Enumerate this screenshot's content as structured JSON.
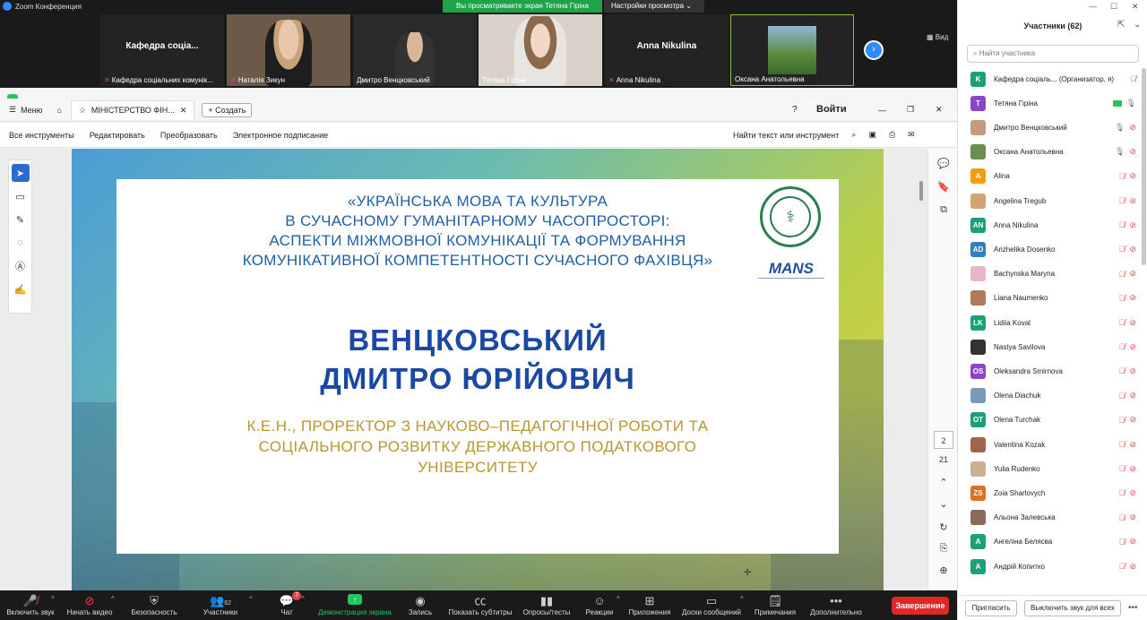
{
  "titlebar": {
    "app_title": "Zoom Конференция"
  },
  "share_banner": {
    "text": "Вы просматриваете экран Тетяна Гіріна",
    "view_settings": "Настройки просмотра"
  },
  "video_strip": {
    "view_label": "Вид",
    "tiles": [
      {
        "big": "Кафедра соціа...",
        "name": "Кафедра соціальних комунік..."
      },
      {
        "big": "",
        "name": "Наталія Зикун"
      },
      {
        "big": "",
        "name": "Дмитро Венцковський"
      },
      {
        "big": "",
        "name": "Тетяна Гіріна"
      },
      {
        "big": "Anna Nikulina",
        "name": "Anna Nikulina"
      },
      {
        "big": "",
        "name": "Оксана Анатольевна"
      }
    ]
  },
  "acrobat": {
    "menu_label": "Меню",
    "tab_title": "МІНІСТЕРСТВО ФІН...",
    "create_label": "Создать",
    "login_label": "Войти",
    "toolbar": {
      "all_tools": "Все инструменты",
      "edit": "Редактировать",
      "convert": "Преобразовать",
      "esign": "Электронное подписание",
      "find": "Найти текст или инструмент"
    },
    "page_current": "2",
    "page_total": "21"
  },
  "slide": {
    "title_lines": [
      "«УКРАЇНСЬКА МОВА ТА КУЛЬТУРА",
      "В СУЧАСНОМУ ГУМАНІТАРНОМУ ЧАСОПРОСТОРІ:",
      "АСПЕКТИ МІЖМОВНОЇ КОМУНІКАЦІЇ ТА ФОРМУВАННЯ",
      "КОМУНІКАТИВНОЇ КОМПЕТЕНТНОСТІ СУЧАСНОГО ФАХІВЦЯ»"
    ],
    "name_lines": [
      "ВЕНЦКОВСЬКИЙ",
      "ДМИТРО ЮРІЙОВИЧ"
    ],
    "position_lines": [
      "К.Е.Н., ПРОРЕКТОР З НАУКОВО–ПЕДАГОГІЧНОЇ РОБОТИ ТА",
      "СОЦІАЛЬНОГО РОЗВИТКУ ДЕРЖАВНОГО ПОДАТКОВОГО",
      "УНІВЕРСИТЕТУ"
    ],
    "logo_text": "MANS"
  },
  "controls": {
    "mute": "Включить звук",
    "video": "Начать видео",
    "security": "Безопасность",
    "participants": "Участники",
    "participants_count": "62",
    "chat": "Чат",
    "chat_badge": "7",
    "share": "Демонстрация экрана",
    "record": "Запись",
    "captions": "Показать субтитры",
    "polls": "Опросы/тесты",
    "reactions": "Реакции",
    "apps": "Приложения",
    "whiteboards": "Доски сообщений",
    "notes": "Примечания",
    "more": "Дополнительно",
    "end": "Завершение"
  },
  "panel": {
    "title": "Участники (62)",
    "search_placeholder": "Найти участника",
    "invite": "Пригласить",
    "mute_all": "Выключить звук для всех",
    "participants": [
      {
        "initials": "K",
        "color": "#1aa17a",
        "name": "Кафедра соціаль... (Организатор, я)",
        "mic": "off",
        "cam": "none"
      },
      {
        "initials": "T",
        "color": "#8e44c9",
        "name": "Тетяна Гіріна",
        "mic": "on",
        "cam": "on"
      },
      {
        "initials": "",
        "color": "#c49a7a",
        "name": "Дмитро Венцковський",
        "mic": "on",
        "cam": "off"
      },
      {
        "initials": "",
        "color": "#6b8e4e",
        "name": "Оксана Анатольевна",
        "mic": "on",
        "cam": "off"
      },
      {
        "initials": "A",
        "color": "#f59e0b",
        "name": "Alina",
        "mic": "off",
        "cam": "off"
      },
      {
        "initials": "",
        "color": "#d4a373",
        "name": "Angelina Tregub",
        "mic": "off",
        "cam": "off"
      },
      {
        "initials": "AN",
        "color": "#1aa17a",
        "name": "Anna Nikulina",
        "mic": "off",
        "cam": "off"
      },
      {
        "initials": "AD",
        "color": "#2f80c0",
        "name": "Anzhelika Dosenko",
        "mic": "off",
        "cam": "off"
      },
      {
        "initials": "",
        "color": "#e8b4c8",
        "name": "Bachynska Maryna",
        "mic": "off",
        "cam": "off"
      },
      {
        "initials": "",
        "color": "#b07a5a",
        "name": "Liana Naumenko",
        "mic": "off",
        "cam": "off"
      },
      {
        "initials": "LK",
        "color": "#1aa17a",
        "name": "Lidiia Koval",
        "mic": "off",
        "cam": "off"
      },
      {
        "initials": "",
        "color": "#333333",
        "name": "Nastya Savilova",
        "mic": "off",
        "cam": "off"
      },
      {
        "initials": "OS",
        "color": "#8e44c9",
        "name": "Oleksandra Smirnova",
        "mic": "off",
        "cam": "off"
      },
      {
        "initials": "",
        "color": "#7a9ab8",
        "name": "Olena Diachuk",
        "mic": "off",
        "cam": "off"
      },
      {
        "initials": "OT",
        "color": "#1aa17a",
        "name": "Olena Turchak",
        "mic": "off",
        "cam": "off"
      },
      {
        "initials": "",
        "color": "#a0664a",
        "name": "Valentina Kozak",
        "mic": "off",
        "cam": "off"
      },
      {
        "initials": "",
        "color": "#c8b090",
        "name": "Yulia Rudenko",
        "mic": "off",
        "cam": "off"
      },
      {
        "initials": "ZS",
        "color": "#e07020",
        "name": "Zoia Sharlovych",
        "mic": "off",
        "cam": "off"
      },
      {
        "initials": "",
        "color": "#8a6a5a",
        "name": "Альона Залевська",
        "mic": "off",
        "cam": "off"
      },
      {
        "initials": "A",
        "color": "#1aa17a",
        "name": "Ангеліна Белясва",
        "mic": "off",
        "cam": "off"
      },
      {
        "initials": "A",
        "color": "#1aa17a",
        "name": "Андрій Копитко",
        "mic": "off",
        "cam": "off"
      }
    ]
  }
}
